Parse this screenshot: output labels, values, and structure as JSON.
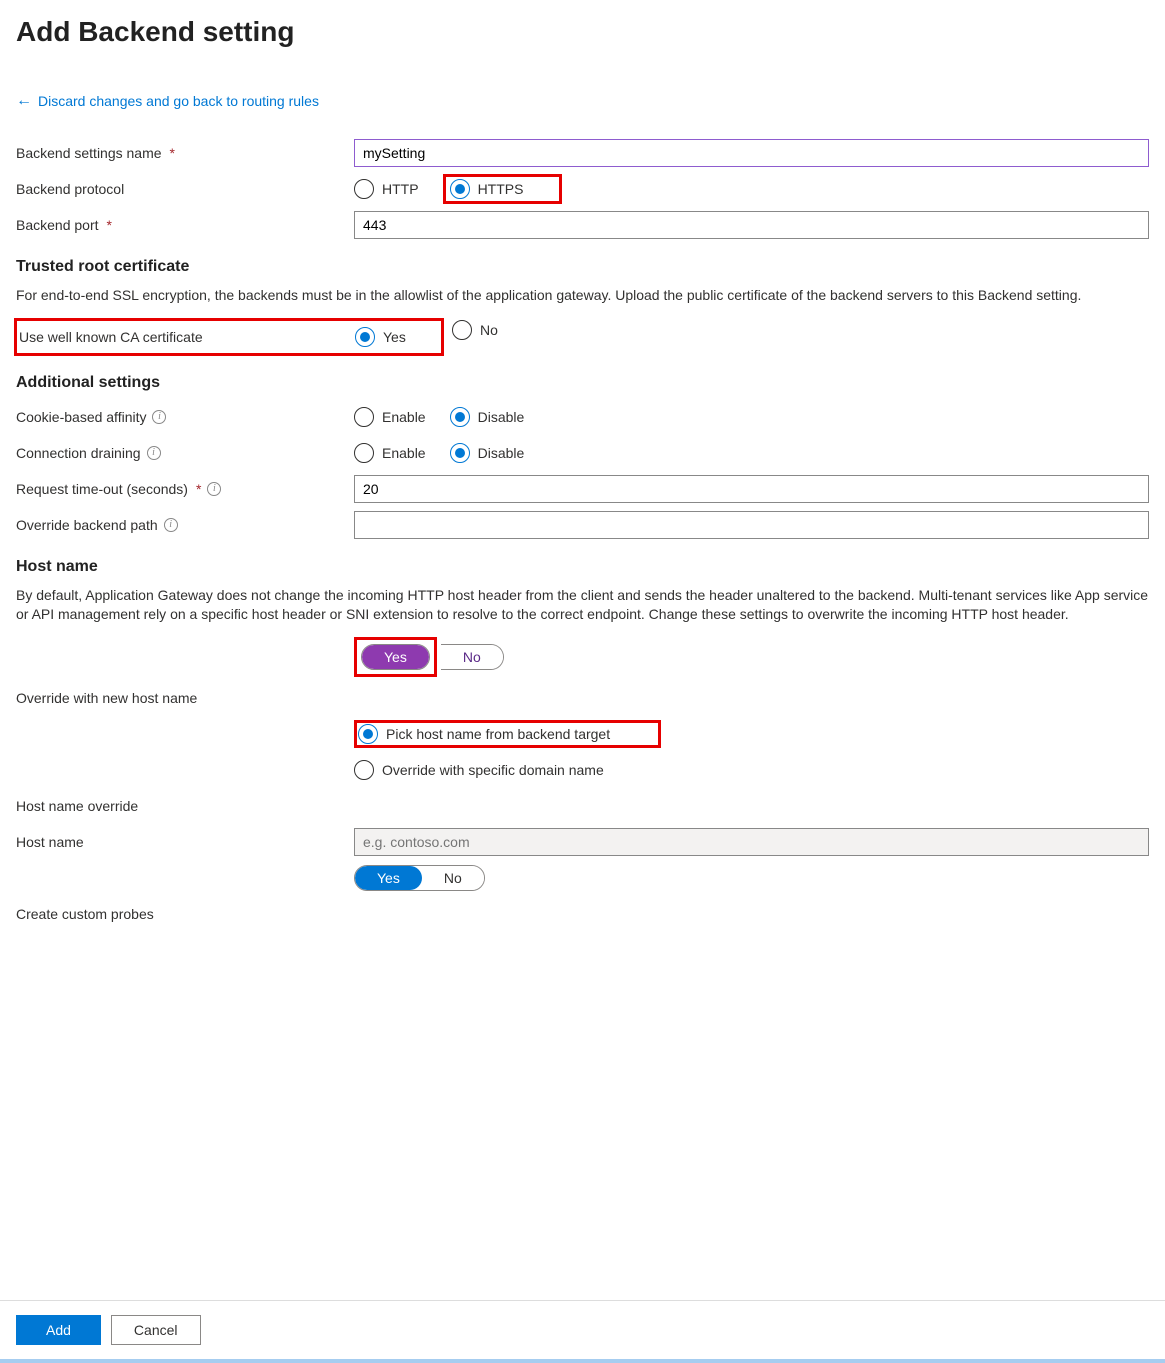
{
  "header": {
    "title": "Add Backend setting"
  },
  "back": {
    "label": "Discard changes and go back to routing rules"
  },
  "fields": {
    "name": {
      "label": "Backend settings name",
      "value": "mySetting"
    },
    "protocol": {
      "label": "Backend protocol",
      "http": "HTTP",
      "https": "HTTPS"
    },
    "port": {
      "label": "Backend port",
      "value": "443"
    }
  },
  "trusted": {
    "heading": "Trusted root certificate",
    "desc": "For end-to-end SSL encryption, the backends must be in the allowlist of the application gateway. Upload the public certificate of the backend servers to this Backend setting.",
    "ca": {
      "label": "Use well known CA certificate",
      "yes": "Yes",
      "no": "No"
    }
  },
  "additional": {
    "heading": "Additional settings",
    "cookie": {
      "label": "Cookie-based affinity",
      "enable": "Enable",
      "disable": "Disable"
    },
    "drain": {
      "label": "Connection draining",
      "enable": "Enable",
      "disable": "Disable"
    },
    "timeout": {
      "label": "Request time-out (seconds)",
      "value": "20"
    },
    "override_path": {
      "label": "Override backend path",
      "value": ""
    }
  },
  "host": {
    "heading": "Host name",
    "desc": "By default, Application Gateway does not change the incoming HTTP host header from the client and sends the header unaltered to the backend. Multi-tenant services like App service or API management rely on a specific host header or SNI extension to resolve to the correct endpoint. Change these settings to overwrite the incoming HTTP host header.",
    "override_new": {
      "label": "Override with new host name",
      "yes": "Yes",
      "no": "No"
    },
    "pick": "Pick host name from backend target",
    "specific": "Override with specific domain name",
    "override_label": "Host name override",
    "hostname": {
      "label": "Host name",
      "placeholder": "e.g. contoso.com"
    },
    "probes": {
      "label": "Create custom probes",
      "yes": "Yes",
      "no": "No"
    }
  },
  "footer": {
    "add": "Add",
    "cancel": "Cancel"
  }
}
